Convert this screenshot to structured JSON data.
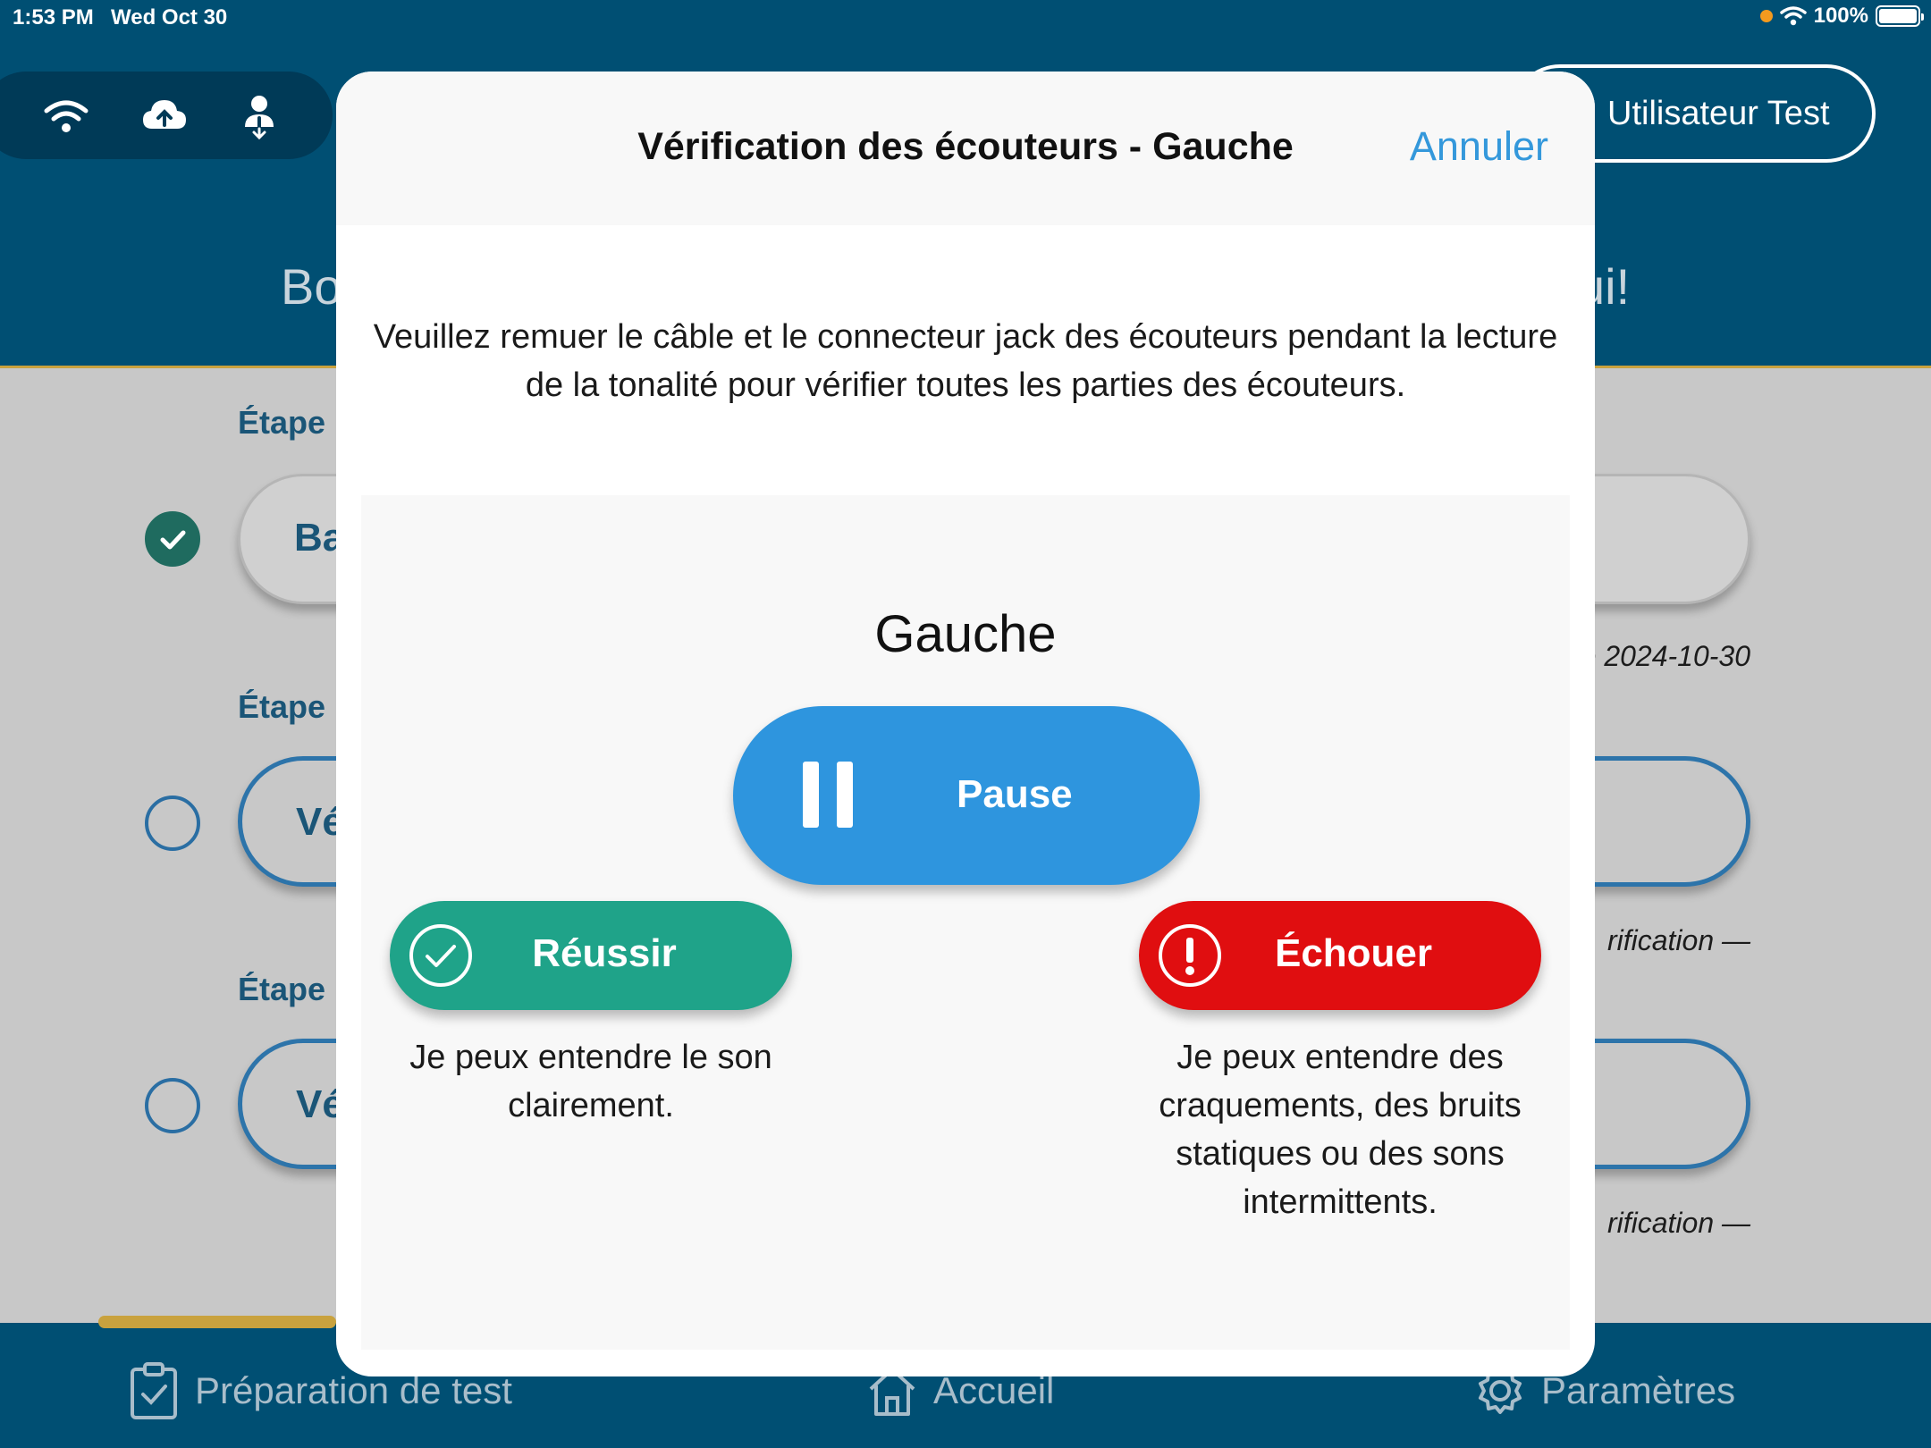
{
  "status_bar": {
    "time": "1:53 PM",
    "date": "Wed Oct 30",
    "battery": "100%"
  },
  "header": {
    "user_name": "Utilisateur Test",
    "greeting_left": "Bo",
    "greeting_right": "ui!"
  },
  "steps": [
    {
      "label": "Étape",
      "button": "Ba",
      "meta": "e 2024-10-30",
      "done": true
    },
    {
      "label": "Étape",
      "button": "Vé",
      "meta": "rification  —",
      "done": false
    },
    {
      "label": "Étape",
      "button": "Vé",
      "meta": "rification  —",
      "done": false
    }
  ],
  "tabs": [
    {
      "label": "Préparation de test",
      "icon": "clipboard-check-icon"
    },
    {
      "label": "Accueil",
      "icon": "home-icon"
    },
    {
      "label": "Paramètres",
      "icon": "gear-icon"
    }
  ],
  "modal": {
    "title": "Vérification des écouteurs - Gauche",
    "cancel": "Annuler",
    "instructions": "Veuillez remuer le câble et le connecteur jack des écouteurs pendant la lecture de la tonalité pour vérifier toutes les parties des écouteurs.",
    "side_title": "Gauche",
    "pause": "Pause",
    "pass": {
      "label": "Réussir",
      "description": "Je peux entendre le son clairement."
    },
    "fail": {
      "label": "Échouer",
      "description": "Je peux entendre des craquements, des bruits statiques ou des sons intermittents."
    }
  },
  "colors": {
    "header": "#004f73",
    "accent_gold": "#c9a23e",
    "pause_blue": "#2e95de",
    "pass_green": "#1fa389",
    "fail_red": "#e00e10",
    "cancel_blue": "#3498db"
  }
}
